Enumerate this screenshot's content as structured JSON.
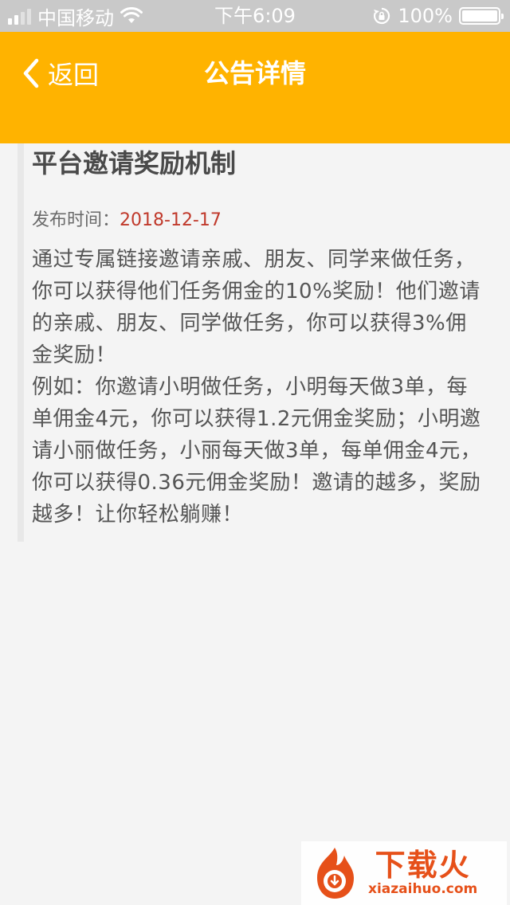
{
  "status_bar": {
    "carrier": "中国移动",
    "time": "下午6:09",
    "battery": "100%",
    "battery_level": 1.0
  },
  "nav": {
    "back_label": "返回",
    "title": "公告详情"
  },
  "article": {
    "title": "平台邀请奖励机制",
    "publish_label": "发布时间：",
    "publish_date": "2018-12-17",
    "paragraphs": [
      "通过专属链接邀请亲戚、朋友、同学来做任务，你可以获得他们任务佣金的10%奖励！他们邀请的亲戚、朋友、同学做任务，你可以获得3%佣金奖励！",
      "例如：你邀请小明做任务，小明每天做3单，每单佣金4元，你可以获得1.2元佣金奖励；小明邀请小丽做任务，小丽每天做3单，每单佣金4元，你可以获得0.36元佣金奖励！邀请的越多，奖励越多！让你轻松躺赚！"
    ]
  },
  "watermark": {
    "main": "下载火",
    "sub": "xiazaihuo.com"
  },
  "colors": {
    "nav_bg": "#ffb300",
    "date": "#c0392b",
    "watermark": "#e65019"
  }
}
